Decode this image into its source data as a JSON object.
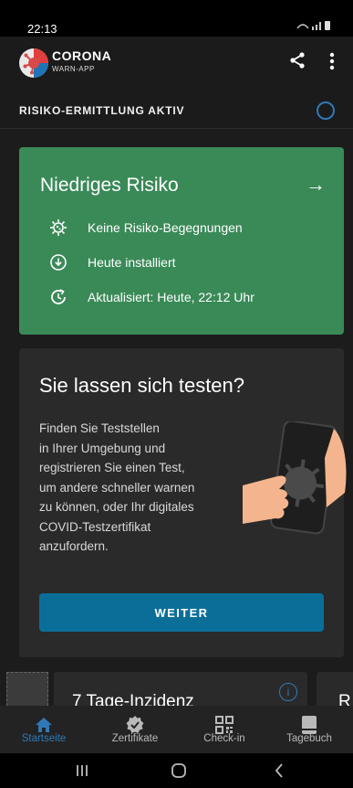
{
  "status_bar": {
    "time": "22:13",
    "indicators": "wifi signal battery"
  },
  "app_bar": {
    "brand_line1": "CORONA",
    "brand_line2": "WARN-APP",
    "share_icon": "share-icon",
    "menu_icon": "more-vert-icon"
  },
  "risk_status": {
    "label": "RISIKO-ERMITTLUNG AKTIV"
  },
  "risk_card": {
    "title": "Niedriges Risiko",
    "color": "#3a8a58",
    "rows": [
      {
        "icon": "virus-icon",
        "text": "Keine Risiko-Begegnungen"
      },
      {
        "icon": "download-icon",
        "text": "Heute installiert"
      },
      {
        "icon": "refresh-clock-icon",
        "text": "Aktualisiert: Heute, 22:12 Uhr"
      }
    ]
  },
  "test_card": {
    "title": "Sie lassen sich testen?",
    "body_lines": [
      "Finden Sie Teststellen",
      "in Ihrer Umgebung und",
      "registrieren Sie einen Test,",
      "um andere schneller warnen",
      "zu können, oder Ihr digitales",
      "COVID-Testzertifikat",
      "anzufordern."
    ],
    "button_label": "WEITER",
    "button_color": "#0b6e99"
  },
  "peek_strip": {
    "tile_b_title": "7 Tage-Inzidenz",
    "tile_c_title": "R"
  },
  "tabs": [
    {
      "label": "Startseite",
      "icon": "home-icon",
      "active": true
    },
    {
      "label": "Zertifikate",
      "icon": "certificate-icon",
      "active": false
    },
    {
      "label": "Check-in",
      "icon": "qr-code-icon",
      "active": false
    },
    {
      "label": "Tagebuch",
      "icon": "diary-icon",
      "active": false
    }
  ],
  "accent": "#2f79b8"
}
